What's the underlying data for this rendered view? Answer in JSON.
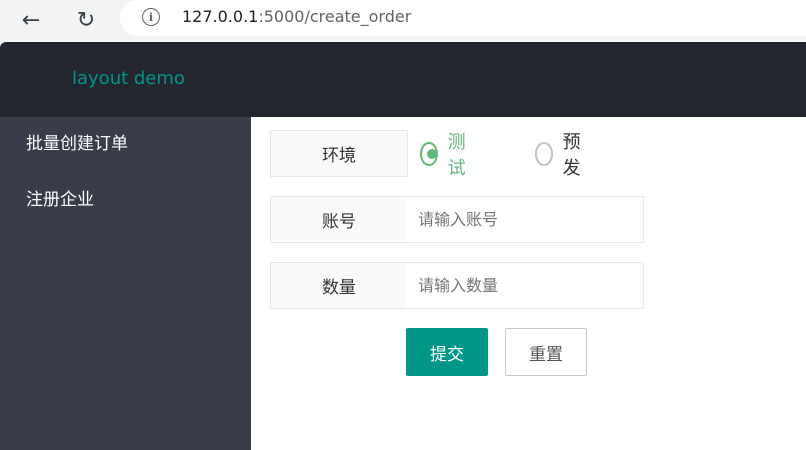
{
  "browser": {
    "url_host": "127.0.0.1",
    "url_rest": ":5000/create_order",
    "back_icon": "←",
    "reload_icon": "↻",
    "info_icon": "i"
  },
  "header": {
    "logo": "layout demo"
  },
  "sidebar": {
    "items": [
      {
        "label": "批量创建订单"
      },
      {
        "label": "注册企业"
      }
    ]
  },
  "form": {
    "env": {
      "label": "环境",
      "options": [
        {
          "label": "测试",
          "checked": true
        },
        {
          "label": "预发",
          "checked": false
        }
      ]
    },
    "account": {
      "label": "账号",
      "placeholder": "请输入账号",
      "value": ""
    },
    "quantity": {
      "label": "数量",
      "placeholder": "请输入数量",
      "value": ""
    },
    "submit_label": "提交",
    "reset_label": "重置"
  },
  "colors": {
    "accent": "#009688",
    "radio_checked": "#5fb878",
    "sidebar_bg": "#393d49",
    "header_bg": "#23262e"
  }
}
